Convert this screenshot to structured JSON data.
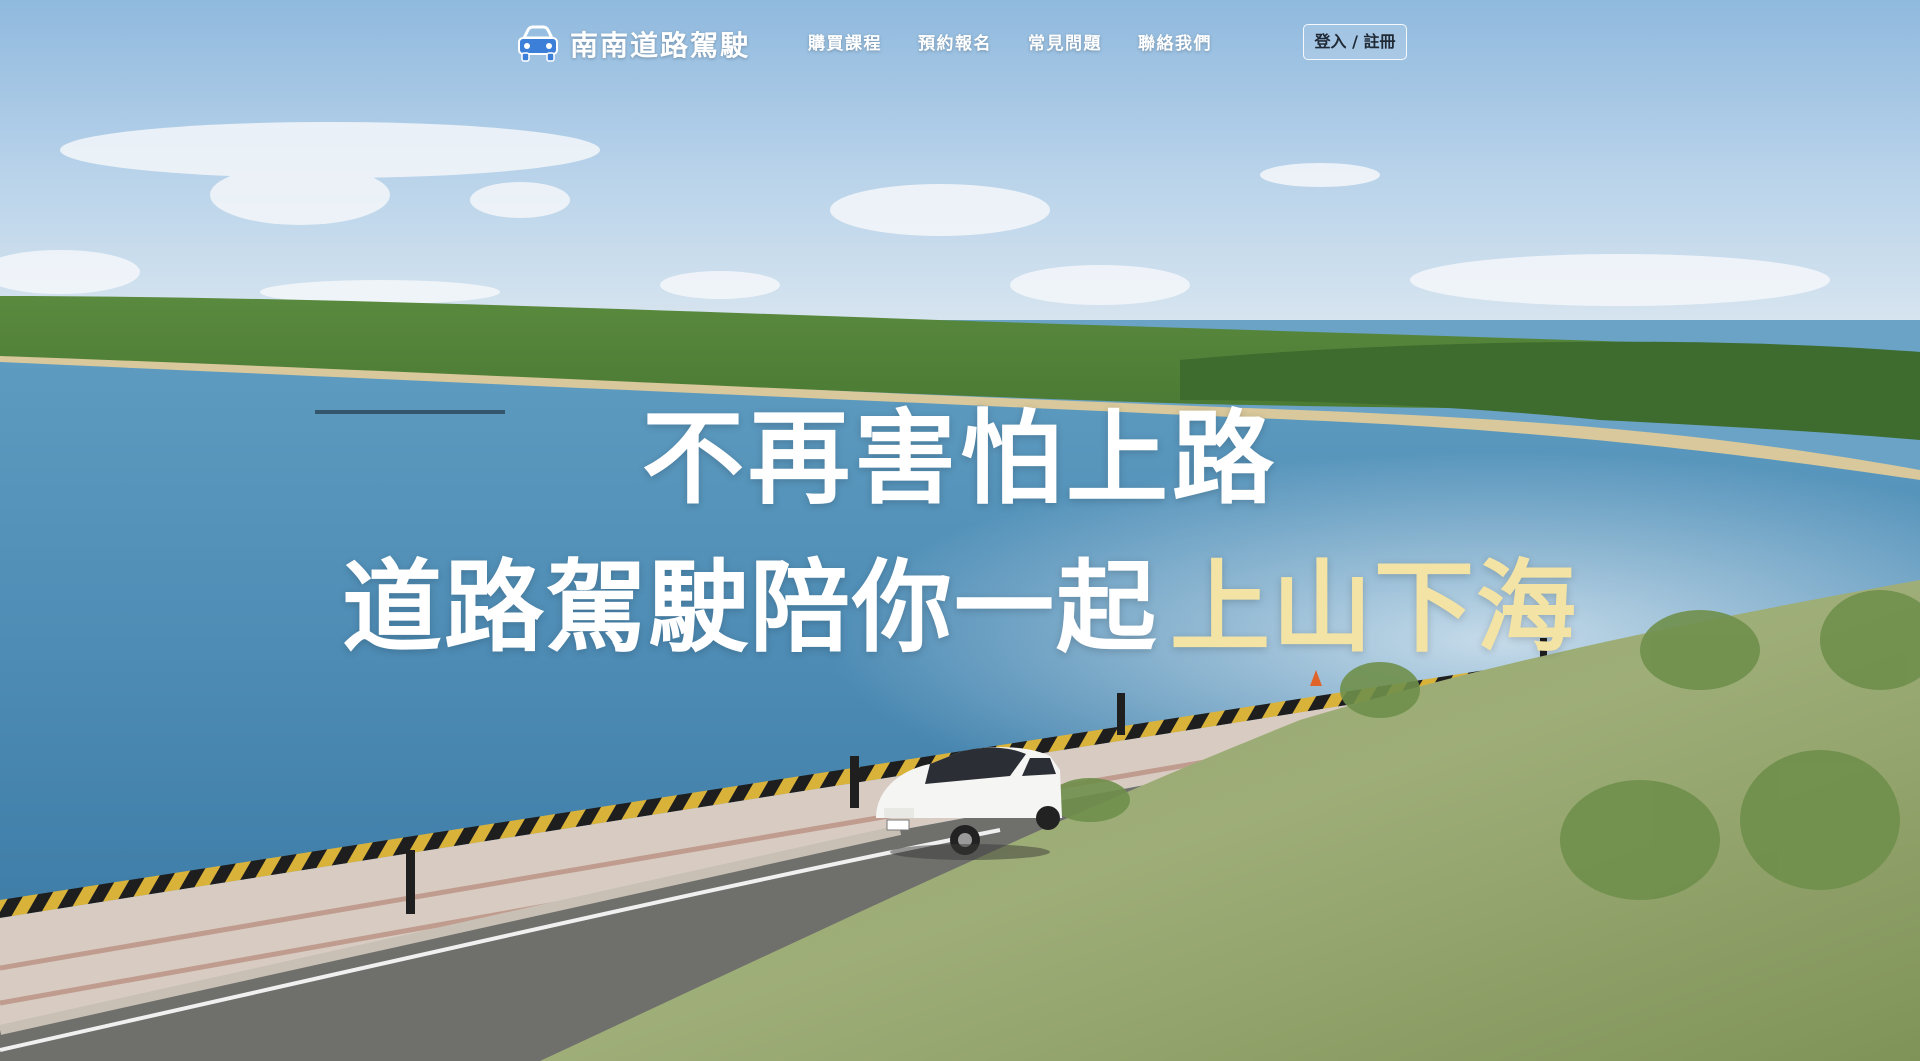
{
  "brand": {
    "name": "南南道路駕駛",
    "icon": "car-icon",
    "icon_color": "#3b7fd8"
  },
  "nav": {
    "items": [
      {
        "label": "購買課程"
      },
      {
        "label": "預約報名"
      },
      {
        "label": "常見問題"
      },
      {
        "label": "聯絡我們"
      }
    ],
    "login_label": "登入 / 註冊"
  },
  "hero": {
    "line1": "不再害怕上路",
    "line2_prefix": "道路駕駛陪你一起",
    "line2_highlight": "上山下海",
    "highlight_color": "#f3e3a4"
  }
}
